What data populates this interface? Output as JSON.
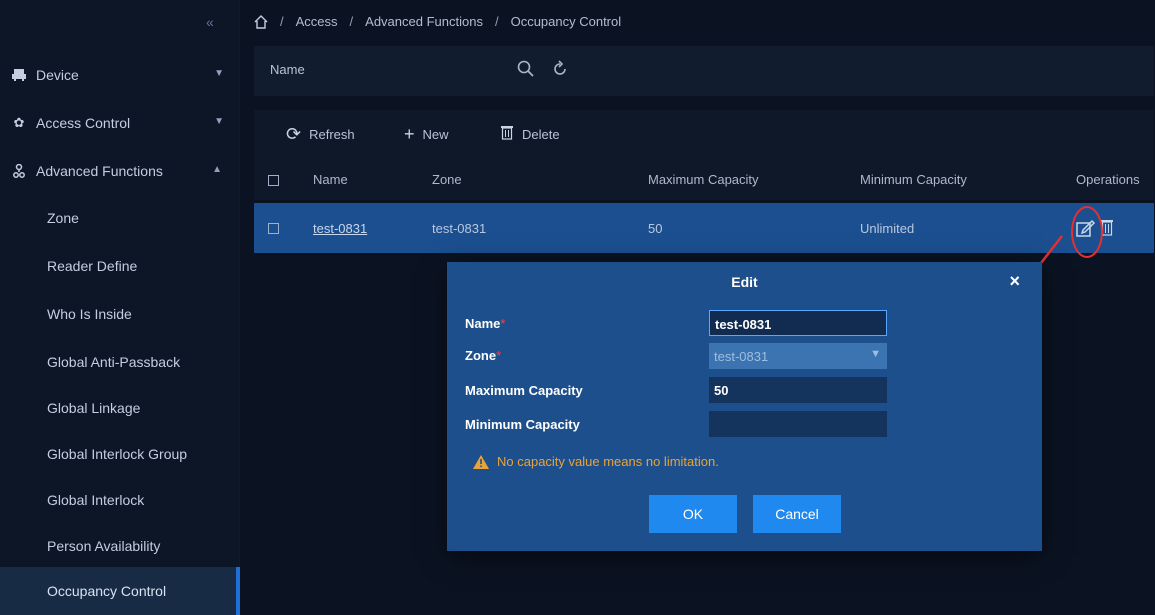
{
  "sidebar": {
    "collapse": "«",
    "top": [
      {
        "label": "Device",
        "icon": "device-icon"
      },
      {
        "label": "Access Control",
        "icon": "gear-icon"
      },
      {
        "label": "Advanced Functions",
        "icon": "network-icon"
      }
    ],
    "sub": [
      "Zone",
      "Reader Define",
      "Who Is Inside",
      "Global Anti-Passback",
      "Global Linkage",
      "Global Interlock Group",
      "Global Interlock",
      "Person Availability",
      "Occupancy Control"
    ],
    "active": "Occupancy Control"
  },
  "breadcrumb": {
    "sep": "/",
    "items": [
      "Access",
      "Advanced Functions",
      "Occupancy Control"
    ]
  },
  "search": {
    "label": "Name",
    "value": ""
  },
  "toolbar": {
    "refresh": "Refresh",
    "new": "New",
    "delete": "Delete"
  },
  "table": {
    "headers": {
      "name": "Name",
      "zone": "Zone",
      "max": "Maximum Capacity",
      "min": "Minimum Capacity",
      "ops": "Operations"
    },
    "rows": [
      {
        "name": "test-0831",
        "zone": "test-0831",
        "max": "50",
        "min": "Unlimited"
      }
    ]
  },
  "modal": {
    "title": "Edit",
    "close": "×",
    "fields": {
      "name_label": "Name",
      "name_value": "test-0831",
      "zone_label": "Zone",
      "zone_value": "test-0831",
      "max_label": "Maximum Capacity",
      "max_value": "50",
      "min_label": "Minimum Capacity",
      "min_value": ""
    },
    "required_mark": "*",
    "warning": "No capacity value means no limitation.",
    "ok": "OK",
    "cancel": "Cancel"
  },
  "colors": {
    "accent": "#2089f0",
    "selected_row": "#1b4f8f",
    "warning": "#e8a43b",
    "annotation": "#e53030"
  }
}
